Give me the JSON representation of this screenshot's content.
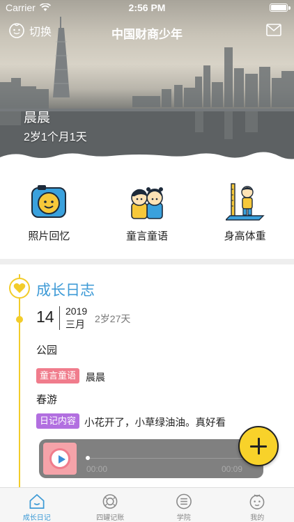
{
  "status_bar": {
    "carrier": "Carrier",
    "time": "2:56 PM"
  },
  "nav": {
    "switch_label": "切换",
    "title": "中国财商少年"
  },
  "profile": {
    "name": "晨晨",
    "age": "2岁1个月1天"
  },
  "features": [
    {
      "label": "照片回忆",
      "icon": "camera-icon"
    },
    {
      "label": "童言童语",
      "icon": "kids-icon"
    },
    {
      "label": "身高体重",
      "icon": "height-icon"
    }
  ],
  "diary": {
    "title": "成长日志",
    "entry": {
      "day": "14",
      "year": "2019",
      "month": "三月",
      "age": "2岁27天",
      "place": "公园",
      "tag1": "童言童语",
      "tag1_text": "晨晨",
      "activity": "春游",
      "tag2": "日记内容",
      "tag2_text": "小花开了，小草绿油油。真好看",
      "audio": {
        "current": "00:00",
        "duration": "00:09",
        "progress": 0
      }
    }
  },
  "tabs": [
    {
      "label": "成长日记",
      "icon": "house-icon",
      "active": true
    },
    {
      "label": "四罐记账",
      "icon": "jar-icon",
      "active": false
    },
    {
      "label": "学院",
      "icon": "list-icon",
      "active": false
    },
    {
      "label": "我的",
      "icon": "baby-face-icon",
      "active": false
    }
  ],
  "colors": {
    "accent": "#3d9ad6",
    "timeline": "#f2cc2a",
    "tag1": "#f07c8c",
    "tag2": "#b26fe0",
    "fab": "#f8d22a"
  }
}
